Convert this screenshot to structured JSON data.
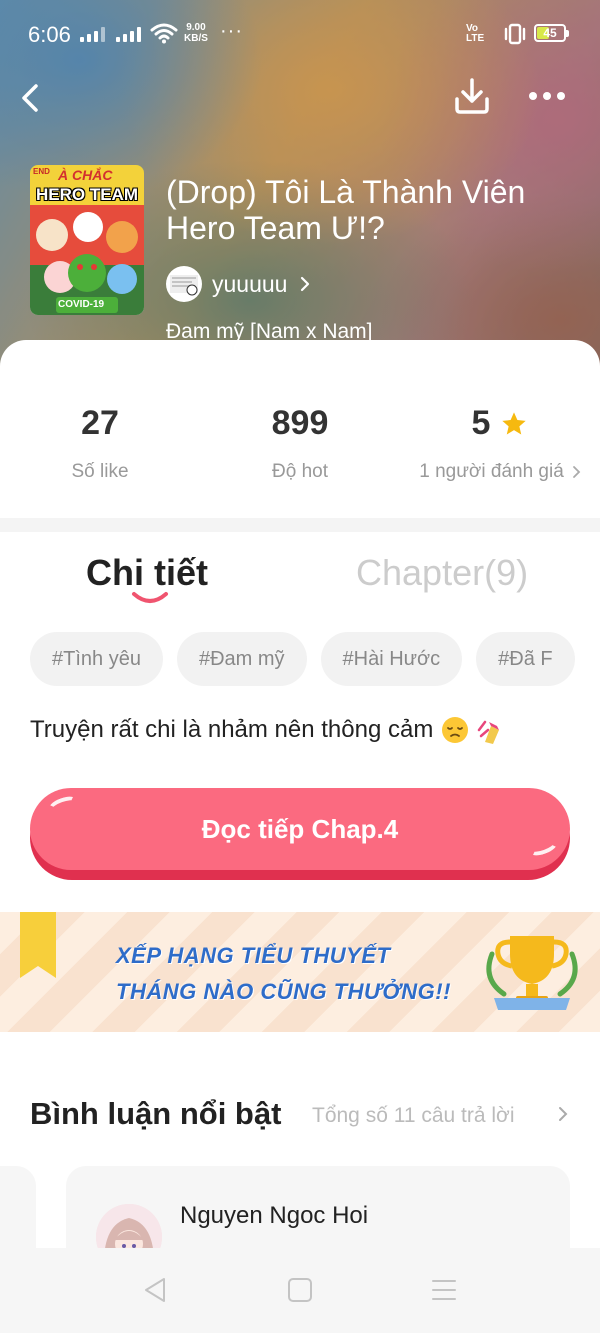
{
  "status_bar": {
    "time": "6:06",
    "net_speed_value": "9.00",
    "net_speed_unit": "KB/S",
    "overflow": "···",
    "volte_top": "Vo",
    "volte_bottom": "LTE",
    "battery": "45"
  },
  "header": {
    "back_icon": "chevron-left-icon",
    "download_icon": "download-icon",
    "more_icon": "more-dots-icon"
  },
  "story": {
    "title": "(Drop) Tôi Là Thành Viên Hero Team Ư!?",
    "author": "yuuuuu",
    "genre": "Đam mỹ [Nam x Nam]",
    "cover_badge": "END",
    "cover_title_top": "À CHẮC",
    "cover_title": "HERO TEAM",
    "cover_caption": "COVID-19"
  },
  "stats": {
    "likes_value": "27",
    "likes_label": "Số like",
    "hot_value": "899",
    "hot_label": "Độ hot",
    "rating_value": "5",
    "rating_label": "1 người đánh giá"
  },
  "tabs": {
    "detail": "Chi tiết",
    "chapters": "Chapter(9)"
  },
  "tags": [
    "#Tình yêu",
    "#Đam mỹ",
    "#Hài Hước",
    "#Đã F"
  ],
  "description": "Truyện rất chi là nhảm nên thông cảm",
  "read_button": "Đọc tiếp Chap.4",
  "banner": {
    "line1": "XẾP HẠNG TIỂU THUYẾT",
    "line2": "THÁNG NÀO CŨNG THƯỞNG!!"
  },
  "comments": {
    "title": "Bình luận nổi bật",
    "total": "Tổng số 11 câu trả lời",
    "first_author": "Nguyen Ngoc Hoi"
  },
  "colors": {
    "accent": "#fb6a80",
    "accent_dark": "#e0304f",
    "star": "#f6b90f",
    "banner_text": "#2e6cc9"
  }
}
